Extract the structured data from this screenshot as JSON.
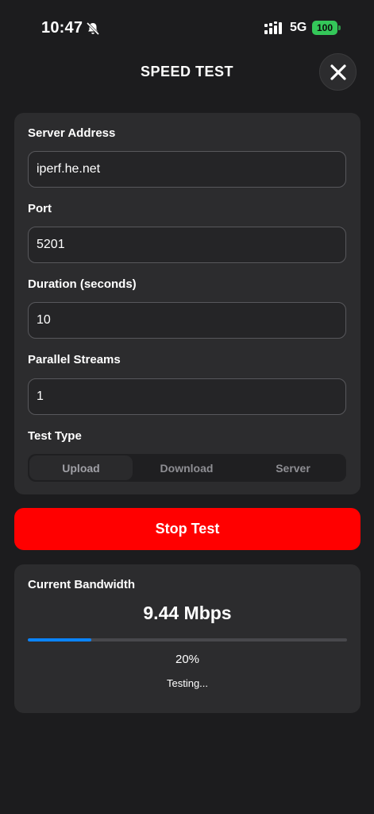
{
  "status_bar": {
    "time": "10:47",
    "network": "5G",
    "battery": "100",
    "icons": [
      "bell-off-icon",
      "signal-icon",
      "battery-icon"
    ]
  },
  "header": {
    "title": "SPEED TEST",
    "close_icon": "close-icon"
  },
  "settings": {
    "server_address": {
      "label": "Server Address",
      "value": "iperf.he.net"
    },
    "port": {
      "label": "Port",
      "value": "5201"
    },
    "duration": {
      "label": "Duration (seconds)",
      "value": "10"
    },
    "streams": {
      "label": "Parallel Streams",
      "value": "1"
    },
    "test_type": {
      "label": "Test Type",
      "options": [
        "Upload",
        "Download",
        "Server"
      ],
      "selected": "Upload"
    }
  },
  "actions": {
    "stop_label": "Stop Test"
  },
  "bandwidth": {
    "label": "Current Bandwidth",
    "value": "9.44 Mbps",
    "progress_percent": 20,
    "progress_text": "20%",
    "status": "Testing..."
  },
  "colors": {
    "background": "#1c1c1e",
    "card": "#2c2c2e",
    "stop_button": "#ff0000",
    "progress": "#0a84ff",
    "battery": "#34c759"
  }
}
